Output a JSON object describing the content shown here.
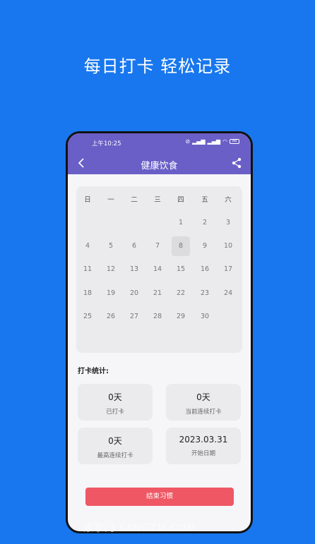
{
  "promo_title": "每日打卡 轻松记录",
  "status_bar": {
    "time": "上午10:25",
    "battery": "88"
  },
  "header": {
    "title": "健康饮食"
  },
  "calendar": {
    "weekdays": [
      "日",
      "一",
      "二",
      "三",
      "四",
      "五",
      "六"
    ],
    "weeks": [
      [
        "",
        "",
        "",
        "",
        "1",
        "2",
        "3"
      ],
      [
        "4",
        "5",
        "6",
        "7",
        "8",
        "9",
        "10"
      ],
      [
        "11",
        "12",
        "13",
        "14",
        "15",
        "16",
        "17"
      ],
      [
        "18",
        "19",
        "20",
        "21",
        "22",
        "23",
        "24"
      ],
      [
        "25",
        "26",
        "27",
        "28",
        "29",
        "30",
        ""
      ]
    ],
    "highlighted_day": "8"
  },
  "stats": {
    "title": "打卡统计:",
    "cards": [
      {
        "value": "0天",
        "label": "已打卡"
      },
      {
        "value": "0天",
        "label": "当前连续打卡"
      },
      {
        "value": "0天",
        "label": "最高连续打卡"
      },
      {
        "value": "2023.03.31",
        "label": "开始日期"
      }
    ]
  },
  "actions": {
    "end_habit": "结束习惯"
  },
  "watermark": "康掌门 KANGZM.COM",
  "colors": {
    "background": "#1877ee",
    "app_bar": "#6a5fc7",
    "end_button": "#ef5764"
  }
}
